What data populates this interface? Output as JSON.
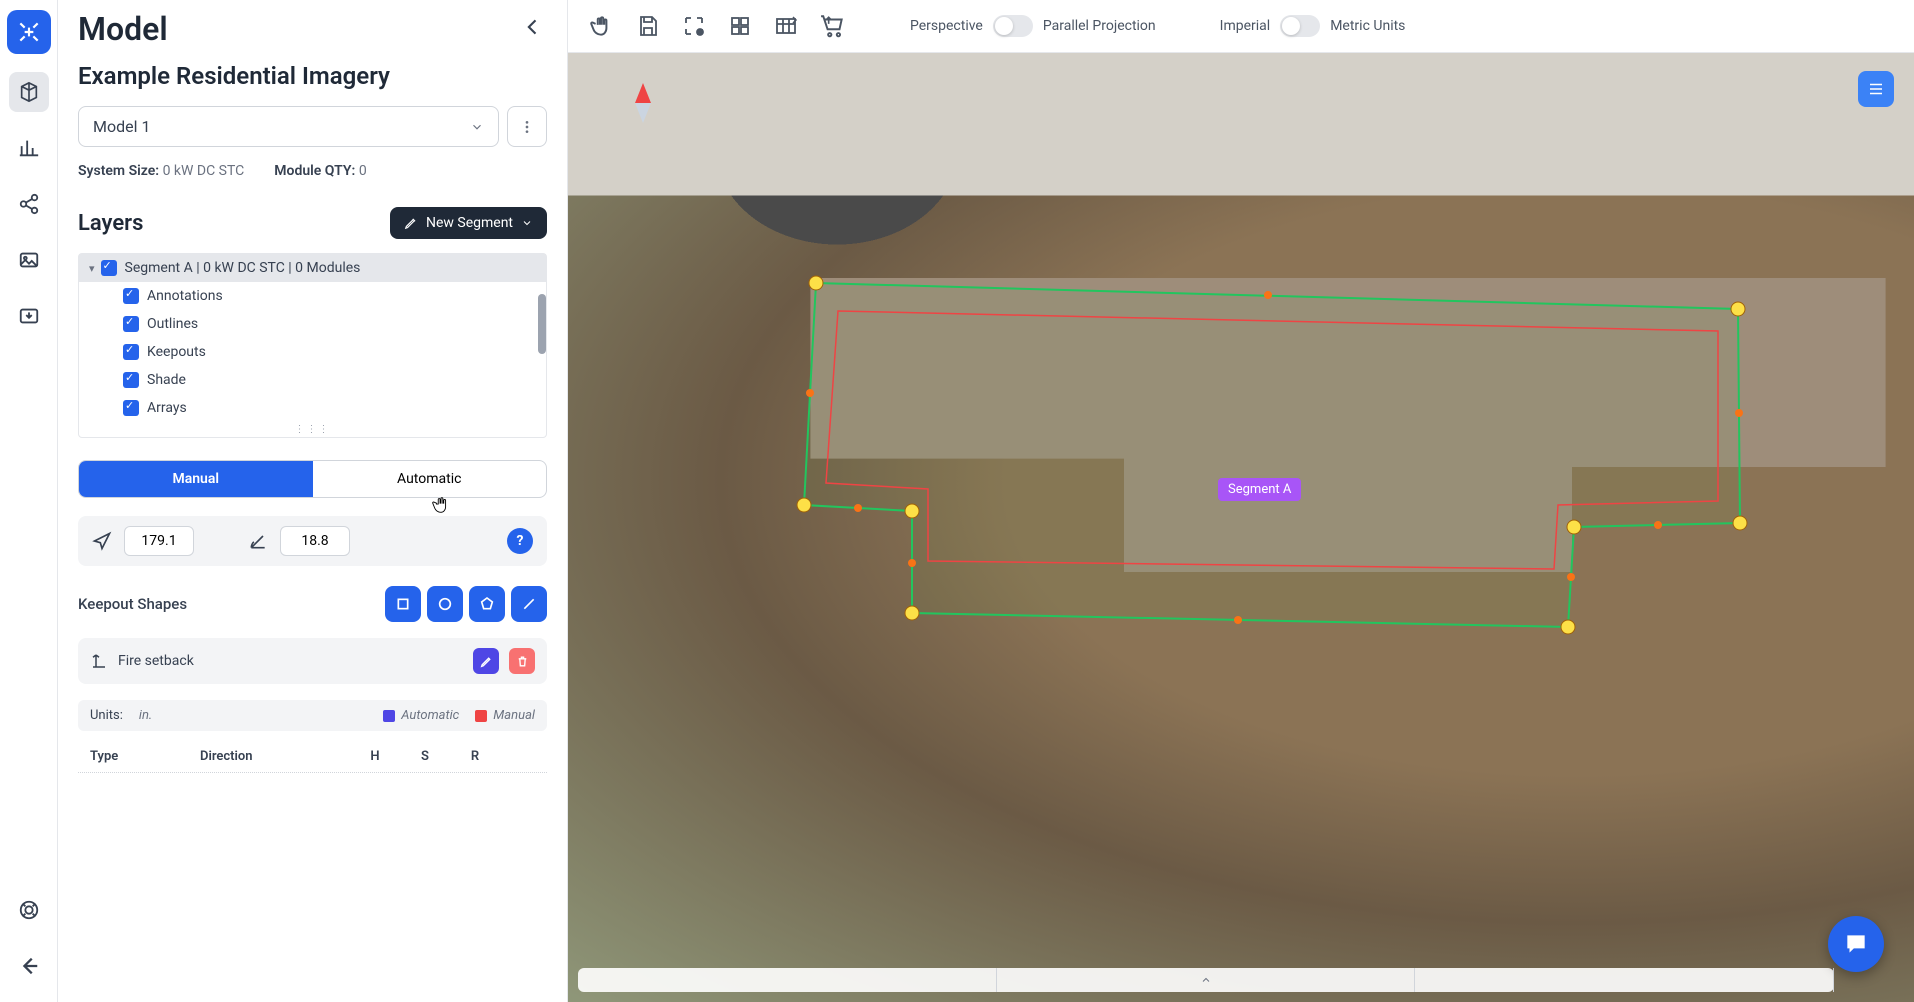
{
  "panel": {
    "title": "Model",
    "subtitle": "Example Residential Imagery",
    "model_selected": "Model 1",
    "system_size_label": "System Size:",
    "system_size_value": "0 kW DC STC",
    "module_qty_label": "Module QTY:",
    "module_qty_value": "0"
  },
  "layers": {
    "title": "Layers",
    "new_segment_label": "New Segment",
    "segment_root": "Segment A | 0 kW DC STC | 0 Modules",
    "children": [
      "Annotations",
      "Outlines",
      "Keepouts",
      "Shade",
      "Arrays"
    ]
  },
  "segmode": {
    "manual": "Manual",
    "automatic": "Automatic"
  },
  "inputs": {
    "azimuth": "179.1",
    "tilt": "18.8"
  },
  "keepout": {
    "label": "Keepout Shapes",
    "fire_label": "Fire setback"
  },
  "units": {
    "label": "Units:",
    "value": "in.",
    "legend_auto": "Automatic",
    "legend_manual": "Manual",
    "color_auto": "#4f46e5",
    "color_manual": "#ef4444"
  },
  "table": {
    "type": "Type",
    "direction": "Direction",
    "h": "H",
    "s": "S",
    "r": "R"
  },
  "toolbar": {
    "perspective": "Perspective",
    "parallel": "Parallel Projection",
    "imperial": "Imperial",
    "metric": "Metric Units"
  },
  "canvas": {
    "segment_label": "Segment A"
  }
}
